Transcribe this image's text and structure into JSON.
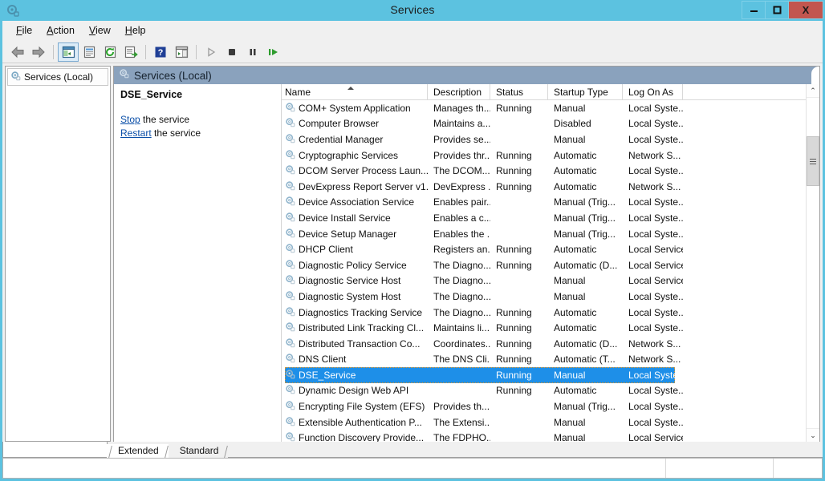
{
  "window": {
    "title": "Services",
    "icon": "services-gear-icon",
    "buttons": {
      "minimize": "–",
      "maximize": "❑",
      "close": "X"
    }
  },
  "menubar": {
    "items": [
      {
        "label": "File",
        "accel": "F",
        "rest": "ile"
      },
      {
        "label": "Action",
        "accel": "A",
        "rest": "ction"
      },
      {
        "label": "View",
        "accel": "V",
        "rest": "iew"
      },
      {
        "label": "Help",
        "accel": "H",
        "rest": "elp"
      }
    ]
  },
  "toolbar": {
    "buttons": [
      "back-icon",
      "forward-icon",
      "show-hide-tree-icon",
      "properties-icon",
      "refresh-icon",
      "export-list-icon",
      "help-icon",
      "show-details-icon",
      "start-service-icon",
      "stop-service-icon",
      "pause-service-icon",
      "restart-service-icon"
    ]
  },
  "tree": {
    "items": [
      {
        "label": "Services (Local)",
        "icon": "services-gear-icon",
        "selected": true
      }
    ]
  },
  "detail": {
    "header_title": "Services (Local)",
    "header_icon": "services-gear-icon",
    "service_name": "DSE_Service",
    "actions": [
      {
        "link": "Stop",
        "suffix": " the service"
      },
      {
        "link": "Restart",
        "suffix": " the service"
      }
    ]
  },
  "list": {
    "columns": [
      {
        "key": "name",
        "label": "Name",
        "sorted": "asc"
      },
      {
        "key": "description",
        "label": "Description"
      },
      {
        "key": "status",
        "label": "Status"
      },
      {
        "key": "startup",
        "label": "Startup Type"
      },
      {
        "key": "logon",
        "label": "Log On As"
      }
    ],
    "rows": [
      {
        "name": "COM+ System Application",
        "description": "Manages th...",
        "status": "Running",
        "startup": "Manual",
        "logon": "Local Syste...",
        "selected": false
      },
      {
        "name": "Computer Browser",
        "description": "Maintains a...",
        "status": "",
        "startup": "Disabled",
        "logon": "Local Syste...",
        "selected": false
      },
      {
        "name": "Credential Manager",
        "description": "Provides se...",
        "status": "",
        "startup": "Manual",
        "logon": "Local Syste...",
        "selected": false
      },
      {
        "name": "Cryptographic Services",
        "description": "Provides thr...",
        "status": "Running",
        "startup": "Automatic",
        "logon": "Network S...",
        "selected": false
      },
      {
        "name": "DCOM Server Process Laun...",
        "description": "The DCOM...",
        "status": "Running",
        "startup": "Automatic",
        "logon": "Local Syste...",
        "selected": false
      },
      {
        "name": "DevExpress Report Server v1...",
        "description": "DevExpress ...",
        "status": "Running",
        "startup": "Automatic",
        "logon": "Network S...",
        "selected": false
      },
      {
        "name": "Device Association Service",
        "description": "Enables pair...",
        "status": "",
        "startup": "Manual (Trig...",
        "logon": "Local Syste...",
        "selected": false
      },
      {
        "name": "Device Install Service",
        "description": "Enables a c...",
        "status": "",
        "startup": "Manual (Trig...",
        "logon": "Local Syste...",
        "selected": false
      },
      {
        "name": "Device Setup Manager",
        "description": "Enables the ...",
        "status": "",
        "startup": "Manual (Trig...",
        "logon": "Local Syste...",
        "selected": false
      },
      {
        "name": "DHCP Client",
        "description": "Registers an...",
        "status": "Running",
        "startup": "Automatic",
        "logon": "Local Service",
        "selected": false
      },
      {
        "name": "Diagnostic Policy Service",
        "description": "The Diagno...",
        "status": "Running",
        "startup": "Automatic (D...",
        "logon": "Local Service",
        "selected": false
      },
      {
        "name": "Diagnostic Service Host",
        "description": "The Diagno...",
        "status": "",
        "startup": "Manual",
        "logon": "Local Service",
        "selected": false
      },
      {
        "name": "Diagnostic System Host",
        "description": "The Diagno...",
        "status": "",
        "startup": "Manual",
        "logon": "Local Syste...",
        "selected": false
      },
      {
        "name": "Diagnostics Tracking Service",
        "description": "The Diagno...",
        "status": "Running",
        "startup": "Automatic",
        "logon": "Local Syste...",
        "selected": false
      },
      {
        "name": "Distributed Link Tracking Cl...",
        "description": "Maintains li...",
        "status": "Running",
        "startup": "Automatic",
        "logon": "Local Syste...",
        "selected": false
      },
      {
        "name": "Distributed Transaction Co...",
        "description": "Coordinates...",
        "status": "Running",
        "startup": "Automatic (D...",
        "logon": "Network S...",
        "selected": false
      },
      {
        "name": "DNS Client",
        "description": "The DNS Cli...",
        "status": "Running",
        "startup": "Automatic (T...",
        "logon": "Network S...",
        "selected": false
      },
      {
        "name": "DSE_Service",
        "description": "",
        "status": "Running",
        "startup": "Manual",
        "logon": "Local Syste...",
        "selected": true
      },
      {
        "name": "Dynamic Design Web API",
        "description": "",
        "status": "Running",
        "startup": "Automatic",
        "logon": "Local Syste...",
        "selected": false
      },
      {
        "name": "Encrypting File System (EFS)",
        "description": "Provides th...",
        "status": "",
        "startup": "Manual (Trig...",
        "logon": "Local Syste...",
        "selected": false
      },
      {
        "name": "Extensible Authentication P...",
        "description": "The Extensi...",
        "status": "",
        "startup": "Manual",
        "logon": "Local Syste...",
        "selected": false
      },
      {
        "name": "Function Discovery Provide...",
        "description": "The FDPHO...",
        "status": "",
        "startup": "Manual",
        "logon": "Local Service",
        "selected": false
      }
    ]
  },
  "scrollbar": {
    "up_arrow": "⌃",
    "down_arrow": "⌄"
  },
  "tabs": [
    {
      "label": "Extended",
      "active": true
    },
    {
      "label": "Standard",
      "active": false
    }
  ],
  "statusbar": {
    "text": ""
  },
  "colors": {
    "accent": "#5cc2e0",
    "selection": "#1e8fe8",
    "close_button": "#c2564f",
    "detail_header": "#8aa2bd",
    "link": "#0b4fa8"
  }
}
